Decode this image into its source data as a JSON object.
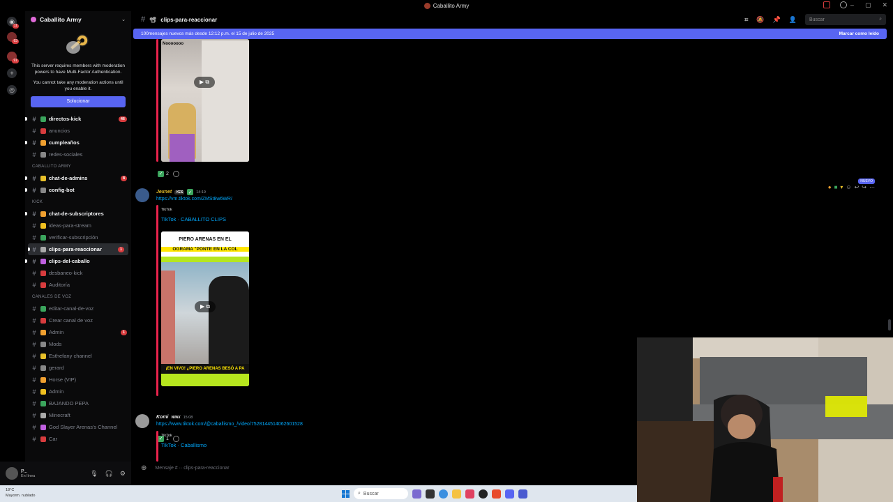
{
  "window": {
    "title": "Caballito Army"
  },
  "rail": {
    "badges": [
      "11",
      "63",
      "91"
    ]
  },
  "server": {
    "name": "Caballito Army",
    "mfa_notice_1": "This server requires members with moderation powers to have Multi-Factor Authentication.",
    "mfa_notice_2": "You cannot take any moderation actions until you enable it.",
    "fix_button": "Solucionar"
  },
  "channels": [
    {
      "label": "directos-kick",
      "badge": "46"
    },
    {
      "label": "anuncios"
    },
    {
      "label": "cumpleaños"
    },
    {
      "label": "redes-sociales"
    },
    {
      "category": "CABALLITO ARMY"
    },
    {
      "label": "chat-de-admins",
      "badge": "8"
    },
    {
      "label": "config-bot"
    },
    {
      "category": "KICK"
    },
    {
      "label": "chat-de-subscriptores"
    },
    {
      "label": "ideas-para-stream"
    },
    {
      "label": "verificar-subscripción"
    },
    {
      "label": "clips-para-reaccionar",
      "badge": "1"
    },
    {
      "label": "clips-del-caballo"
    },
    {
      "label": "desbaneo-kick"
    },
    {
      "label": "Auditoría"
    },
    {
      "category": "CANALES DE VOZ"
    },
    {
      "label": "editar-canal-de-voz"
    },
    {
      "label": "Crear canal de voz"
    },
    {
      "label": "Admin",
      "badge": "1"
    },
    {
      "label": "Mods"
    },
    {
      "label": "Esthefany channel"
    },
    {
      "label": "gerard"
    },
    {
      "label": "Horse (VIP)"
    },
    {
      "label": "Admin"
    },
    {
      "label": "BAJANDO PEPA"
    },
    {
      "label": "Minecraft"
    },
    {
      "label": "God Slayer Arenas's Channel"
    },
    {
      "label": "Car"
    }
  ],
  "user": {
    "name": "P...",
    "status": "En línea"
  },
  "chat": {
    "channel": "clips-para-reaccionar",
    "search_placeholder": "Buscar",
    "new_messages": "100mensajes nuevos más desde 12:12 p.m. el 15 de julio de 2025",
    "mark_read": "Marcar como leído",
    "composer_placeholder": "Mensaje # ·· clips-para-reaccionar",
    "nuevo": "NUEVO"
  },
  "messages": [
    {
      "video_caption": "Nooooooo",
      "reaction_count": "2"
    },
    {
      "author": "Jexnet",
      "tag": "YES",
      "time": "14:19",
      "link": "https://vm.tiktok.com/ZMSt8w6WR/",
      "embed_site": "TikTok",
      "embed_title": "TikTok · CABALLITO CLIPS",
      "video_headline_1": "PIERO ARENAS EN EL",
      "video_headline_2": "OGRAMA \"PONTE EN LA COL",
      "video_footer": "¡EN VIVO! ¿PIERO ARENAS BESÓ A PA",
      "reaction_count": "1"
    },
    {
      "author": "Komi",
      "tag": "WINX",
      "time": "15:08",
      "link": "https://www.tiktok.com/@caballismo_/video/7528144514062601528",
      "embed_site": "TikTok",
      "embed_title": "TikTok · Caballismo"
    }
  ],
  "taskbar": {
    "weather_temp": "18°C",
    "weather_desc": "Mayorm. nublado",
    "search": "Buscar"
  }
}
